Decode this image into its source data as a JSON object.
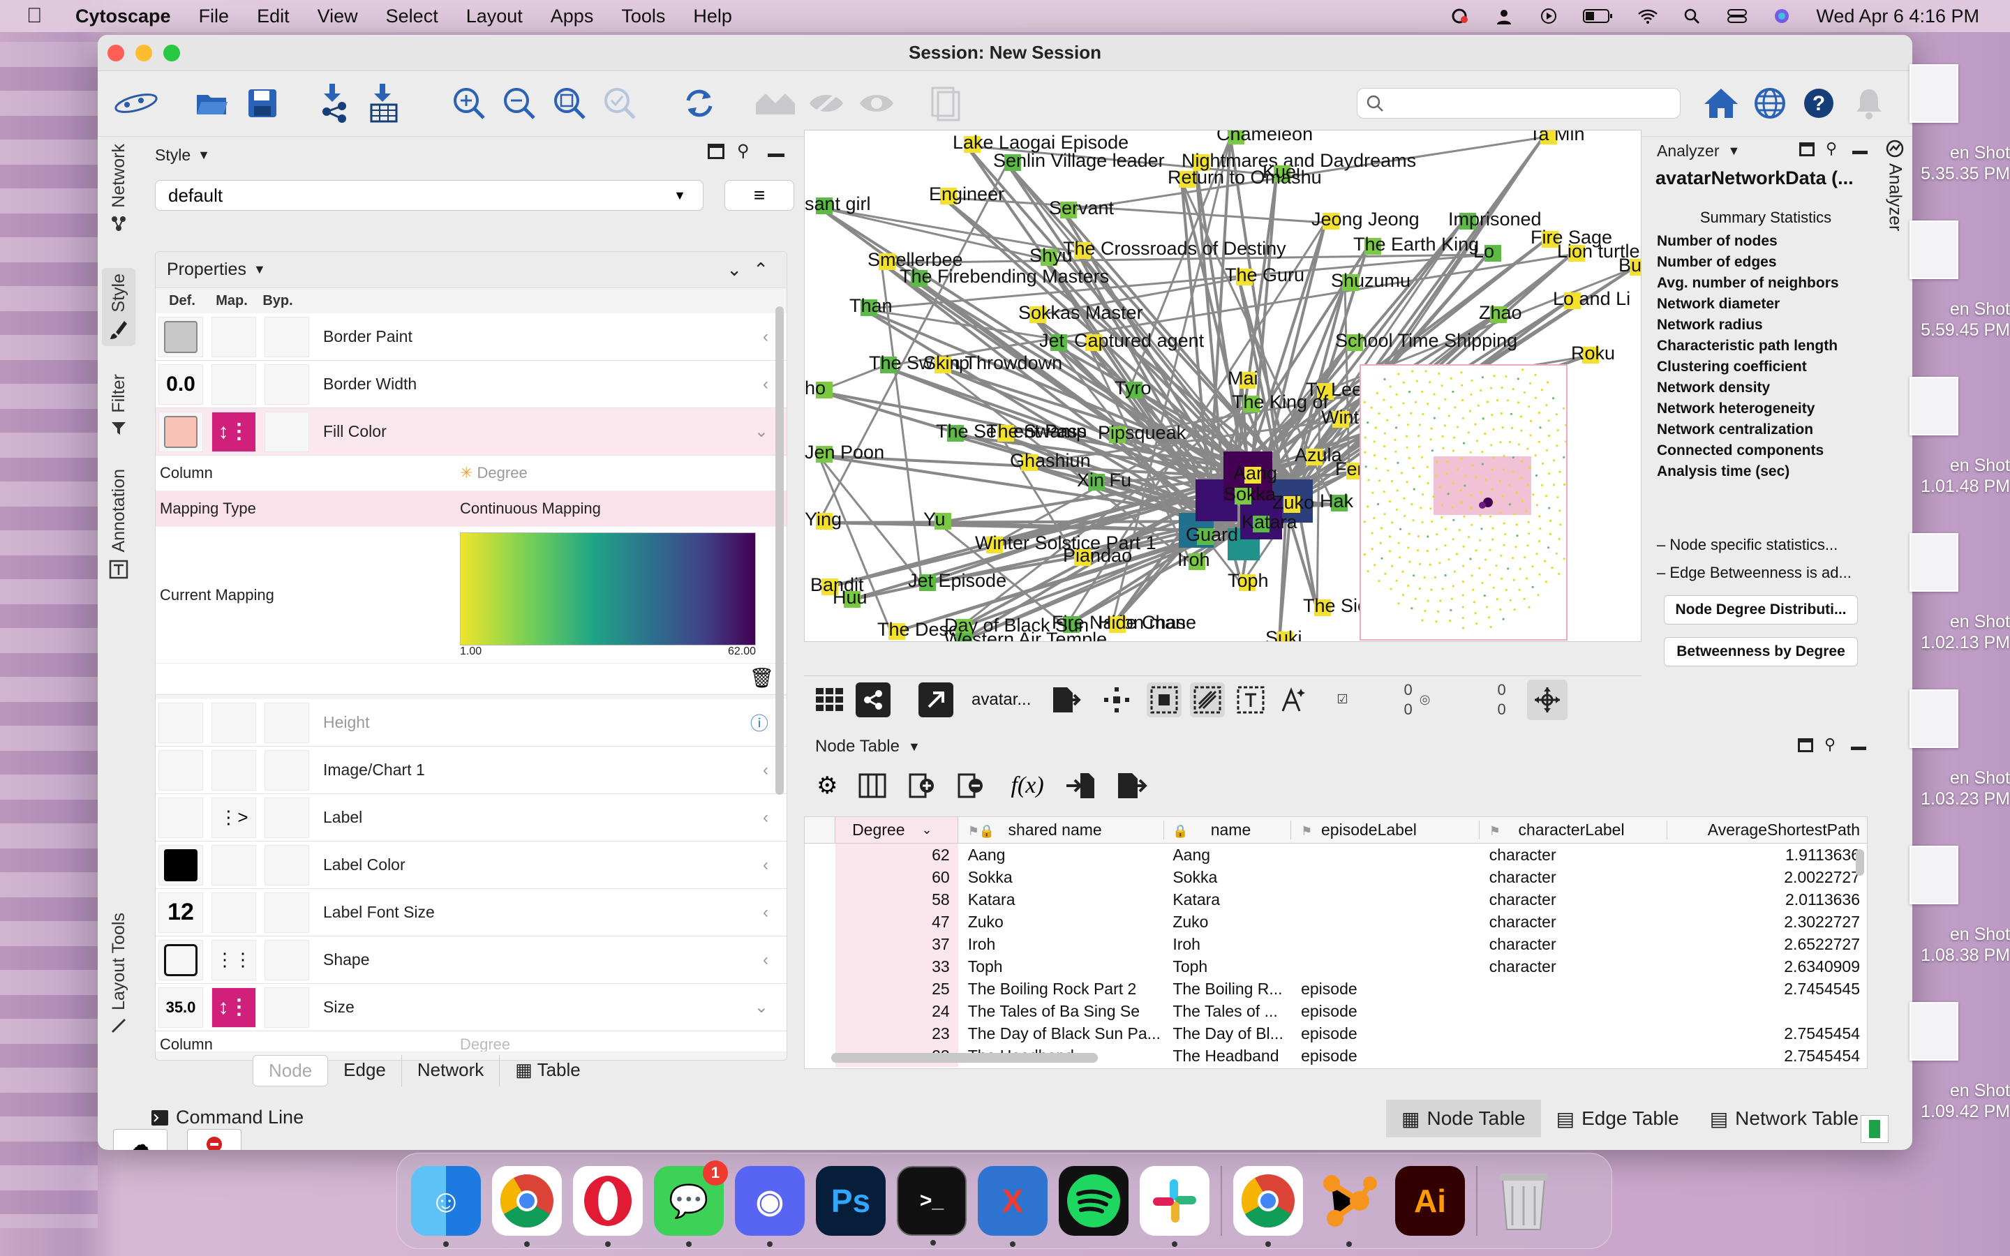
{
  "menubar": {
    "app_name": "Cytoscape",
    "items": [
      "File",
      "Edit",
      "View",
      "Select",
      "Layout",
      "Apps",
      "Tools",
      "Help"
    ],
    "datetime": "Wed Apr 6  4:16 PM"
  },
  "window": {
    "title": "Session: New Session"
  },
  "left_tabs": [
    "Network",
    "Style",
    "Filter",
    "Annotation",
    "Layout Tools"
  ],
  "style_panel": {
    "header": "Style",
    "style_name": "default",
    "properties_label": "Properties",
    "col_def": "Def.",
    "col_map": "Map.",
    "col_byp": "Byp.",
    "rows": [
      {
        "name": "Border Paint",
        "def": ""
      },
      {
        "name": "Border Width",
        "def": "0.0"
      },
      {
        "name": "Fill Color",
        "def": ""
      },
      {
        "name": "Height",
        "def": ""
      },
      {
        "name": "Image/Chart 1",
        "def": ""
      },
      {
        "name": "Label",
        "def": ""
      },
      {
        "name": "Label Color",
        "def": ""
      },
      {
        "name": "Label Font Size",
        "def": "12"
      },
      {
        "name": "Shape",
        "def": ""
      },
      {
        "name": "Size",
        "def": "35.0"
      }
    ],
    "mapping": {
      "column_label": "Column",
      "column_value": "Degree",
      "type_label": "Mapping Type",
      "type_value": "Continuous Mapping",
      "current_label": "Current Mapping",
      "min": "1.00",
      "max": "62.00"
    },
    "size_column_label": "Column",
    "size_column_value": "Degree",
    "tabs": [
      "Node",
      "Edge",
      "Network",
      "Table"
    ]
  },
  "network": {
    "labels": [
      "Lake Laogai Episode",
      "Chameleon",
      "Ta Min",
      "Senlin Village leader",
      "Nightmares and Daydreams",
      "Kuei",
      "Return to Omashu",
      "sant girl",
      "Engineer",
      "Servant",
      "Jeong Jeong",
      "Imprisoned",
      "Fire Sage",
      "The Earth King",
      "Lion turtle",
      "Lo",
      "Smellerbee",
      "Shyu",
      "The Crossroads of Destiny",
      "The Firebending Masters",
      "The Guru",
      "Shuzumu",
      "Bu",
      "Than",
      "Sokkas Master",
      "Zhao",
      "Lo and Li",
      "Jet",
      "Captured agent",
      "School Time Shipping",
      "Roku",
      "The Swamp",
      "Skin Throwdown",
      "ho",
      "Mai",
      "Tyro",
      "Ty Lee",
      "The King of",
      "Winter So",
      "The Serpent Pass",
      "The Swamp",
      "Pipsqueak",
      "Azula",
      "Hak",
      "Female",
      "Jen Poon",
      "Ghashiun",
      "Xin Fu",
      "Aang",
      "Sokka",
      "Zuko",
      "Katara",
      "Ying",
      "Yu",
      "Winter Solstice Part 1",
      "Guard",
      "Piandao",
      "Iroh",
      "Toph",
      "Jet Episode",
      "Bandit",
      "Huu",
      "The Sie",
      "Fire Nation man",
      "The Desert",
      "Day of Black Sun",
      "Hide Chase",
      "Western Air Temple",
      "Suki"
    ]
  },
  "netbar": {
    "network_name": "avatar...",
    "sel_nodes": "0",
    "sel_edges": "0",
    "hid_nodes": "0",
    "hid_edges": "0"
  },
  "analyzer": {
    "header": "Analyzer",
    "title": "avatarNetworkData (...",
    "summary": "Summary Statistics",
    "stats": [
      "Number of nodes",
      "Number of edges",
      "Avg. number of neighbors",
      "Network diameter",
      "Network radius",
      "Characteristic path length",
      "Clustering coefficient",
      "Network density",
      "Network heterogeneity",
      "Network centralization",
      "Connected components",
      "Analysis time (sec)"
    ],
    "notes": [
      "– Node specific statistics...",
      "– Edge Betweenness is ad..."
    ],
    "buttons": [
      "Node Degree Distributi...",
      "Betweenness by Degree"
    ],
    "side_tab": "Analyzer"
  },
  "node_table": {
    "header": "Node Table",
    "columns": [
      "Degree",
      "shared name",
      "name",
      "episodeLabel",
      "characterLabel",
      "AverageShortestPath"
    ],
    "rows": [
      [
        "62",
        "Aang",
        "Aang",
        "",
        "character",
        "1.9113636"
      ],
      [
        "60",
        "Sokka",
        "Sokka",
        "",
        "character",
        "2.0022727"
      ],
      [
        "58",
        "Katara",
        "Katara",
        "",
        "character",
        "2.0113636"
      ],
      [
        "47",
        "Zuko",
        "Zuko",
        "",
        "character",
        "2.3022727"
      ],
      [
        "37",
        "Iroh",
        "Iroh",
        "",
        "character",
        "2.6522727"
      ],
      [
        "33",
        "Toph",
        "Toph",
        "",
        "character",
        "2.6340909"
      ],
      [
        "25",
        "The Boiling Rock Part 2",
        "The Boiling R...",
        "episode",
        "",
        "2.7454545"
      ],
      [
        "24",
        "The Tales of Ba Sing Se",
        "The Tales of ...",
        "episode",
        "",
        ""
      ],
      [
        "23",
        "The Day of Black Sun Pa...",
        "The Day of Bl...",
        "episode",
        "",
        "2.7545454"
      ],
      [
        "23",
        "The Headband",
        "The Headband",
        "episode",
        "",
        "2.7545454"
      ]
    ]
  },
  "bottom_tabs": [
    "Node Table",
    "Edge Table",
    "Network Table"
  ],
  "command_line": "Command Line",
  "dock": {
    "messages_badge": "1"
  },
  "desktop_shots": [
    {
      "line1": "en Shot",
      "line2": "5.35.35 PM"
    },
    {
      "line1": "en Shot",
      "line2": "5.59.45 PM"
    },
    {
      "line1": "en Shot",
      "line2": "1.01.48 PM"
    },
    {
      "line1": "en Shot",
      "line2": "1.02.13 PM"
    },
    {
      "line1": "en Shot",
      "line2": "1.03.23 PM"
    },
    {
      "line1": "en Shot",
      "line2": "1.08.38 PM"
    },
    {
      "line1": "en Shot",
      "line2": "1.09.42 PM"
    }
  ]
}
